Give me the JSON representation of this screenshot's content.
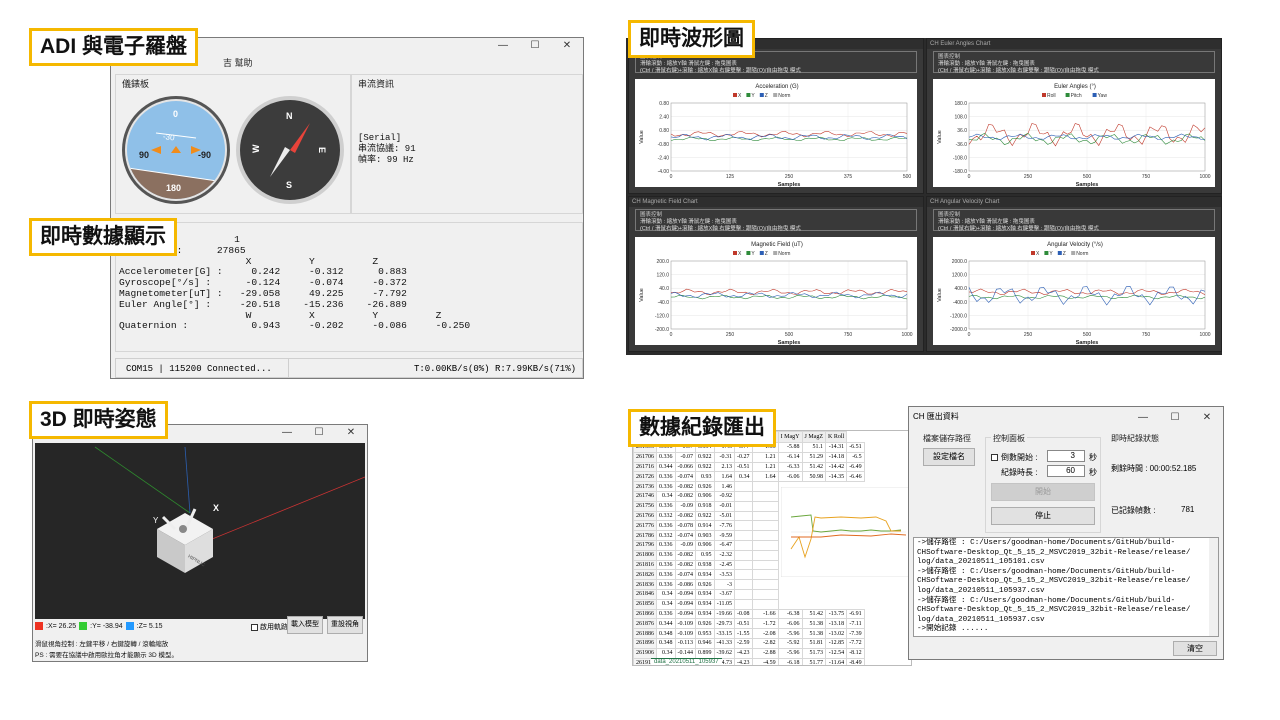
{
  "labels": {
    "adi": "ADI 與電子羅盤",
    "waveform": "即時波形圖",
    "realtime_data": "即時數據顯示",
    "pose3d": "3D 即時姿態",
    "export": "數據紀錄匯出"
  },
  "adi_window": {
    "menu_partial": "吉  幫助",
    "instrument_panel": "儀錶板",
    "stream_info": "串流資訊",
    "serial_info": [
      "[Serial]",
      "串流協議: 91",
      "幀率: 99 Hz"
    ],
    "attitude_marks": {
      "top": "0",
      "upper": "-30",
      "left": "90",
      "right": "-90",
      "bottom": "180"
    },
    "compass_marks": {
      "n": "N",
      "s": "S",
      "e": "E",
      "w": "W"
    },
    "data_lines": [
      "      ID :          1",
      "Timestamp :      27865",
      "                      X          Y          Z",
      "Accelerometer[G] :     0.242     -0.312      0.883",
      "Gyroscope[°/s] :      -0.124     -0.074     -0.372",
      "Magnetometer[uT] :   -29.058     49.225     -7.792",
      "Euler Angle[°] :     -20.518    -15.236    -26.889",
      "                      W          X          Y          Z",
      "Quaternion :           0.943     -0.202     -0.086     -0.250"
    ],
    "status_left": "COM15 | 115200 Connected...",
    "status_right": "T:0.00KB/s(0%) R:7.99KB/s(71%)"
  },
  "charts": {
    "ctrl_title": "圖表控制",
    "ctrl_line1": "滑輪滾動 : 縮放Y軸        滑鼠左鍵 : 拖曳圖表",
    "ctrl_line2": "(Ctrl / 滑鼠右鍵)+滾輪 : 縮放X軸   右鍵雙擊 : 跟隨(O)/自由拖曳 模式",
    "xlabel": "Samples",
    "ylabel": "Value",
    "panels": [
      {
        "window_title": "CH Acceleration Chart",
        "title": "Acceleration (G)",
        "legend": [
          "X",
          "Y",
          "Z",
          "Norm"
        ],
        "yticks": [
          "0.80",
          "2.40",
          "0.80",
          "-0.80",
          "-2.40",
          "-4.00"
        ],
        "xticks": [
          "0",
          "125",
          "250",
          "375",
          "500"
        ]
      },
      {
        "window_title": "CH Euler Angles Chart",
        "title": "Euler Angles (°)",
        "legend": [
          "Roll",
          "Pitch",
          "Yaw"
        ],
        "yticks": [
          "180.0",
          "108.0",
          "36.0",
          "-36.0",
          "-108.0",
          "-180.0"
        ],
        "xticks": [
          "0",
          "250",
          "500",
          "750",
          "1000"
        ]
      },
      {
        "window_title": "CH Magnetic Field Chart",
        "title": "Magnetic Field (uT)",
        "legend": [
          "X",
          "Y",
          "Z",
          "Norm"
        ],
        "yticks": [
          "200.0",
          "120.0",
          "40.0",
          "-40.0",
          "-120.0",
          "-200.0"
        ],
        "xticks": [
          "0",
          "250",
          "500",
          "750",
          "1000"
        ]
      },
      {
        "window_title": "CH Angular Velocity Chart",
        "title": "Angular Velocity (°/s)",
        "legend": [
          "X",
          "Y",
          "Z",
          "Norm"
        ],
        "yticks": [
          "2000.0",
          "1200.0",
          "400.0",
          "-400.0",
          "-1200.0",
          "-2000.0"
        ],
        "xticks": [
          "0",
          "250",
          "500",
          "750",
          "1000"
        ]
      }
    ]
  },
  "pose_window": {
    "readout_x": ":X= 26.25",
    "readout_y": ":Y= -38.94",
    "readout_z": ":Z= 5.15",
    "trail_checkbox": "啟用軌跡",
    "load_model": "載入模型",
    "reset_view": "重設視角",
    "help_line1": "滑鼠視角控制 : 左鍵平移 / 右鍵旋轉 / 滾輪縮放",
    "help_line2": "PS : 需要在協議中啟用歐拉角才能顯示 3D 模型。",
    "cube_text": "HIPNUC",
    "axis_x": "X",
    "axis_y": "Y"
  },
  "export_window": {
    "title": "CH 匯出資料",
    "storage_group": "檔案儲存路徑",
    "set_filename": "設定檔名",
    "control_group": "控制面板",
    "countdown_label": "倒數開始 :",
    "countdown_value": "3",
    "duration_label": "紀錄時長 :",
    "duration_value": "60",
    "sec": "秒",
    "start": "開始",
    "stop": "停止",
    "status_group": "即時紀錄狀態",
    "remaining": "剩餘時間 : 00:00:52.185",
    "frames_label": "已記錄幀數 :",
    "frames_value": "781",
    "log": [
      "->儲存路徑 : C:/Users/goodman-home/Documents/GitHub/build-",
      "CHSoftware-Desktop_Qt_5_15_2_MSVC2019_32bit-Release/release/",
      "log/data_20210511_105101.csv",
      "->儲存路徑 : C:/Users/goodman-home/Documents/GitHub/build-",
      "CHSoftware-Desktop_Qt_5_15_2_MSVC2019_32bit-Release/release/",
      "log/data_20210511_105937.csv",
      "->儲存路徑 : C:/Users/goodman-home/Documents/GitHub/build-",
      "CHSoftware-Desktop_Qt_5_15_2_MSVC2019_32bit-Release/release/",
      "log/data_20210511_105937.csv",
      "->開始記錄 ......"
    ],
    "clear": "清空"
  },
  "spreadsheet": {
    "headers": [
      "MagX",
      "MagY",
      "MagZ",
      "Roll"
    ],
    "col_letters": [
      "H",
      "I",
      "J",
      "K"
    ],
    "sheet_tab": "data_20210511_105937",
    "rows": [
      [
        "261696",
        "0.336",
        "-0.07",
        "0.934",
        "1.46",
        "0.77",
        "1.33",
        "-5.88",
        "51.1",
        "-14.31",
        "-6.51"
      ],
      [
        "261706",
        "0.336",
        "-0.07",
        "0.922",
        "-0.31",
        "-0.27",
        "1.21",
        "-6.14",
        "51.29",
        "-14.18",
        "-6.5"
      ],
      [
        "261716",
        "0.344",
        "-0.066",
        "0.922",
        "2.13",
        "-0.51",
        "1.21",
        "-6.33",
        "51.42",
        "-14.42",
        "-6.49"
      ],
      [
        "261726",
        "0.336",
        "-0.074",
        "0.93",
        "1.64",
        "0.34",
        "1.64",
        "-6.06",
        "50.98",
        "-14.35",
        "-6.46"
      ],
      [
        "261736",
        "0.336",
        "-0.082",
        "0.926",
        "1.46",
        "",
        ""
      ],
      [
        "261746",
        "0.34",
        "-0.082",
        "0.906",
        "-0.92",
        "",
        ""
      ],
      [
        "261756",
        "0.336",
        "-0.09",
        "0.918",
        "-0.01",
        "",
        ""
      ],
      [
        "261766",
        "0.332",
        "-0.082",
        "0.922",
        "-5.01",
        "",
        ""
      ],
      [
        "261776",
        "0.336",
        "-0.078",
        "0.914",
        "-7.76",
        "",
        ""
      ],
      [
        "261786",
        "0.332",
        "-0.074",
        "0.903",
        "-9.59",
        "",
        ""
      ],
      [
        "261796",
        "0.336",
        "-0.09",
        "0.906",
        "-6.47",
        "",
        ""
      ],
      [
        "261806",
        "0.336",
        "-0.082",
        "0.95",
        "-2.32",
        "",
        ""
      ],
      [
        "261816",
        "0.336",
        "-0.082",
        "0.938",
        "-2.45",
        "",
        ""
      ],
      [
        "261826",
        "0.336",
        "-0.074",
        "0.934",
        "-3.53",
        "",
        ""
      ],
      [
        "261836",
        "0.336",
        "-0.086",
        "0.926",
        "-3",
        "",
        ""
      ],
      [
        "261846",
        "0.34",
        "-0.094",
        "0.934",
        "-3.67",
        "",
        ""
      ],
      [
        "261856",
        "0.34",
        "-0.094",
        "0.934",
        "-11.05",
        "",
        ""
      ],
      [
        "261866",
        "0.336",
        "-0.094",
        "0.934",
        "-19.66",
        "-0.08",
        "-1.66",
        "-6.38",
        "51.42",
        "-13.75",
        "-6.91"
      ],
      [
        "261876",
        "0.344",
        "-0.109",
        "0.926",
        "-29.73",
        "-0.51",
        "-1.72",
        "-6.06",
        "51.38",
        "-13.18",
        "-7.11"
      ],
      [
        "261886",
        "0.348",
        "-0.109",
        "0.953",
        "-33.15",
        "-1.55",
        "-2.08",
        "-5.96",
        "51.38",
        "-13.02",
        "-7.39"
      ],
      [
        "261896",
        "0.348",
        "-0.113",
        "0.946",
        "-41.33",
        "-2.59",
        "-2.82",
        "-5.92",
        "51.81",
        "-12.85",
        "-7.72"
      ],
      [
        "261906",
        "0.34",
        "-0.144",
        "0.899",
        "-39.62",
        "-4.23",
        "-2.88",
        "-5.96",
        "51.73",
        "-12.54",
        "-8.12"
      ],
      [
        "261916",
        "0.328",
        "-0.094",
        "0.91",
        "-34.73",
        "-4.23",
        "-4.59",
        "-6.18",
        "51.77",
        "-11.64",
        "-8.49"
      ],
      [
        "261926",
        "0.332",
        "-0.125",
        "0.926",
        "-43.58",
        "-0.57",
        "-3.43",
        "-6.18",
        "52.08",
        "-11.64",
        "-8.83"
      ]
    ]
  }
}
